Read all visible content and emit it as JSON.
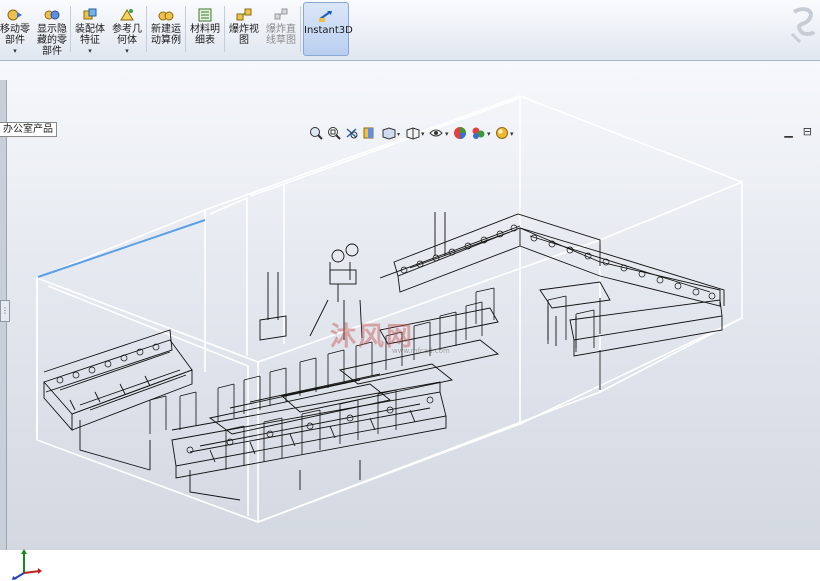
{
  "toolbar": {
    "buttons": [
      {
        "label": "移动零\n部件",
        "icon": "move-component-icon"
      },
      {
        "label": "显示隐\n藏的零\n部件",
        "icon": "show-hidden-icon"
      },
      {
        "label": "装配体\n特征",
        "icon": "assembly-feature-icon"
      },
      {
        "label": "参考几\n何体",
        "icon": "reference-geometry-icon"
      },
      {
        "label": "新建运\n动算例",
        "icon": "motion-study-icon"
      },
      {
        "label": "材料明\n细表",
        "icon": "bom-icon"
      },
      {
        "label": "爆炸视\n图",
        "icon": "exploded-view-icon"
      },
      {
        "label": "爆炸直\n线草图",
        "icon": "explode-line-sketch-icon"
      },
      {
        "label": "Instant3D",
        "icon": "instant3d-icon"
      }
    ]
  },
  "document_tab": {
    "label": "办公室产品"
  },
  "view_toolbar": {
    "icons": [
      "zoom-to-fit-icon",
      "zoom-area-icon",
      "previous-view-icon",
      "section-view-icon",
      "view-orientation-icon",
      "display-style-icon",
      "hide-show-items-icon",
      "edit-appearance-icon",
      "apply-scene-icon",
      "view-settings-icon"
    ]
  },
  "window_controls": {
    "restore": "▁",
    "maximize": "⊟"
  },
  "watermark": {
    "text": "沐风网",
    "sub": "www.mfcad.com"
  },
  "colors": {
    "accent": "#5aa0e6",
    "wire": "#111111",
    "room": "#ffffff"
  }
}
